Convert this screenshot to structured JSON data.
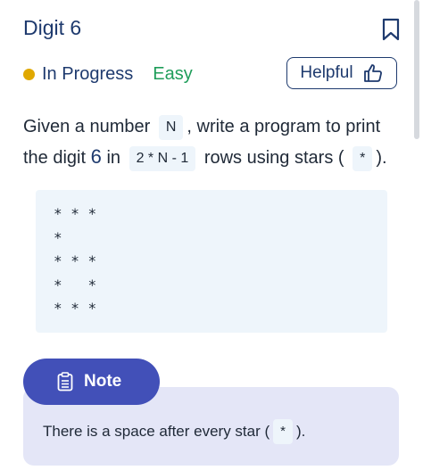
{
  "header": {
    "title": "Digit 6"
  },
  "status": {
    "state": "In Progress",
    "state_color": "#e0a800",
    "difficulty": "Easy",
    "difficulty_color": "#1f9d5a"
  },
  "helpful_button": {
    "label": "Helpful",
    "icon": "thumbs-up-icon"
  },
  "description": {
    "part1": "Given a number",
    "code_n": "N",
    "part2": ", write a program to print the digit",
    "digit": "6",
    "part3": "in",
    "code_rows": "2 * N - 1",
    "part4": "rows using stars (",
    "code_star": "*",
    "part5": ")."
  },
  "pattern": "* * *\n*\n* * *\n*   *\n* * *",
  "note": {
    "title": "Note",
    "text_before": "There is a space after every star (",
    "code_star": "*",
    "text_after": ")."
  },
  "colors": {
    "primary": "#1e3a6e",
    "note_accent": "#4250b8",
    "code_bg": "#eef5fb"
  }
}
